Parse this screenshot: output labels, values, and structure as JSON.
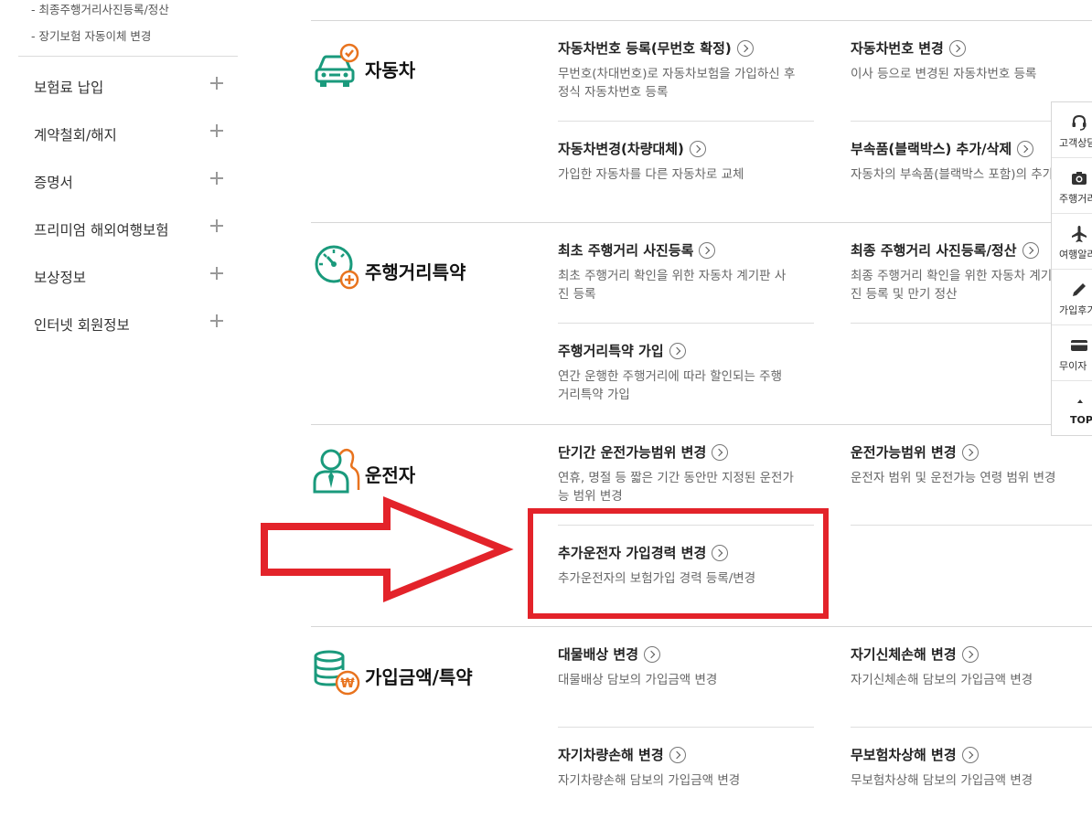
{
  "sidebar": {
    "sub_links": [
      "- 최종주행거리사진등록/정산",
      "- 장기보험 자동이체 변경"
    ],
    "menu": [
      {
        "label": "보험료 납입"
      },
      {
        "label": "계약철회/해지"
      },
      {
        "label": "증명서"
      },
      {
        "label": "프리미엄 해외여행보험"
      },
      {
        "label": "보상정보"
      },
      {
        "label": "인터넷 회원정보"
      }
    ]
  },
  "sections": {
    "car": {
      "title": "자동차",
      "items": [
        {
          "title": "자동차번호 등록(무번호 확정)",
          "desc": "무번호(차대번호)로 자동차보험을 가입하신 후",
          "desc2": "정식 자동차번호 등록"
        },
        {
          "title": "자동차번호 변경",
          "desc": "이사 등으로 변경된 자동차번호 등록",
          "desc2": ""
        },
        {
          "title": "자동차변경(차량대체)",
          "desc": "가입한 자동차를 다른 자동차로 교체",
          "desc2": ""
        },
        {
          "title": "부속품(블랙박스) 추가/삭제",
          "desc": "자동차의 부속품(블랙박스 포함)의 추가",
          "desc2": ""
        }
      ]
    },
    "mileage": {
      "title": "주행거리특약",
      "items": [
        {
          "title": "최초 주행거리 사진등록",
          "desc": "최초 주행거리 확인을 위한 자동차 계기판 사",
          "desc2": "진 등록"
        },
        {
          "title": "최종 주행거리 사진등록/정산",
          "desc": "최종 주행거리 확인을 위한 자동차 계기판 사",
          "desc2": "진 등록 및 만기 정산"
        },
        {
          "title": "주행거리특약 가입",
          "desc": "연간 운행한 주행거리에 따라 할인되는 주행",
          "desc2": "거리특약 가입"
        }
      ]
    },
    "driver": {
      "title": "운전자",
      "items": [
        {
          "title": "단기간 운전가능범위 변경",
          "desc": "연휴, 명절 등 짧은 기간 동안만 지정된 운전가",
          "desc2": "능 범위 변경"
        },
        {
          "title": "운전가능범위 변경",
          "desc": "운전자 범위 및 운전가능 연령 범위 변경",
          "desc2": ""
        },
        {
          "title": "추가운전자 가입경력 변경",
          "desc": "추가운전자의 보험가입 경력 등록/변경",
          "desc2": ""
        }
      ]
    },
    "coverage": {
      "title": "가입금액/특약",
      "items": [
        {
          "title": "대물배상 변경",
          "desc": "대물배상 담보의 가입금액 변경",
          "desc2": ""
        },
        {
          "title": "자기신체손해 변경",
          "desc": "자기신체손해 담보의 가입금액 변경",
          "desc2": ""
        },
        {
          "title": "자기차량손해 변경",
          "desc": "자기차량손해 담보의 가입금액 변경",
          "desc2": ""
        },
        {
          "title": "무보험차상해 변경",
          "desc": "무보험차상해 담보의 가입금액 변경",
          "desc2": ""
        }
      ]
    }
  },
  "quick_menu": {
    "items": [
      {
        "label": "고객상담",
        "icon": "headset-icon"
      },
      {
        "label": "주행거리",
        "icon": "camera-icon"
      },
      {
        "label": "여행알리미",
        "icon": "airplane-icon"
      },
      {
        "label": "가입후기",
        "icon": "pencil-icon"
      },
      {
        "label": "무이자",
        "icon": "card-icon"
      }
    ],
    "top_label": "TOP"
  },
  "colors": {
    "accent_green": "#1a9a7c",
    "accent_orange": "#e8731e",
    "annotation_red": "#e3232a"
  }
}
